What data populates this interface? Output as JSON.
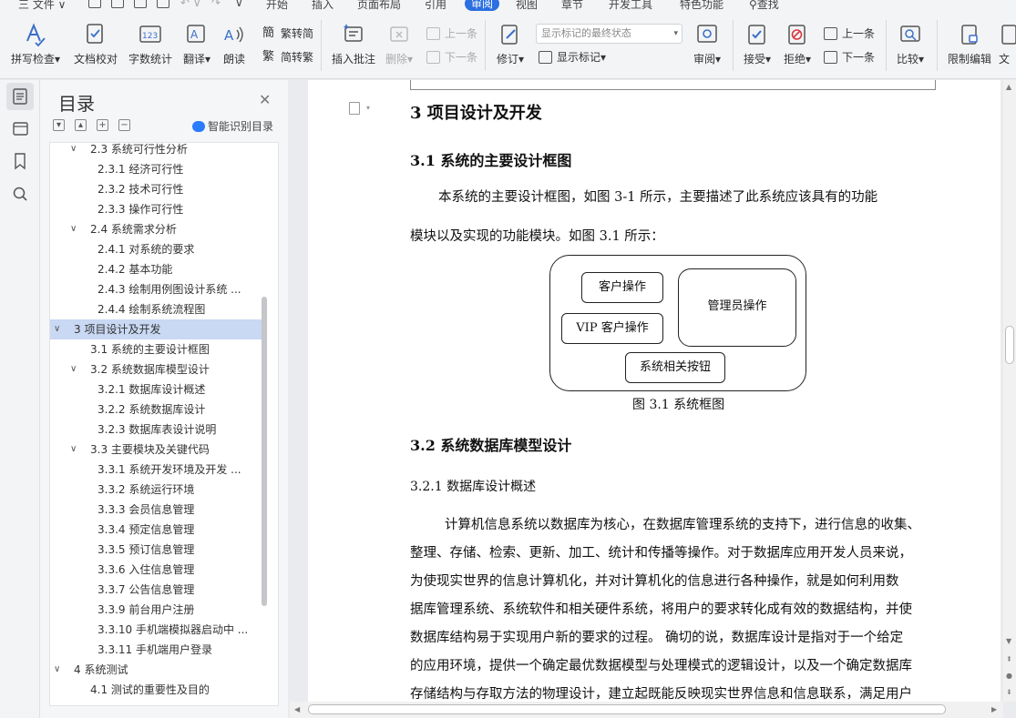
{
  "menubar": {
    "file": "三 文件 ∨",
    "tabs": [
      "开始",
      "插入",
      "页面布局",
      "引用",
      "审阅",
      "视图",
      "章节",
      "开发工具",
      "特色功能"
    ],
    "active_tab": "审阅",
    "search": "查找"
  },
  "toolbar": {
    "spellcheck": "拼写检查",
    "doc_proof": "文档校对",
    "word_count": "字数统计",
    "translate": "翻译",
    "read_aloud": "朗读",
    "trad_to_simp": "繁转简",
    "simp_to_trad": "简转繁",
    "insert_comment": "插入批注",
    "delete": "删除",
    "prev_comment": "上一条",
    "next_comment": "下一条",
    "revise": "修订",
    "markup_state": "显示标记的最终状态",
    "show_markup": "显示标记",
    "review": "审阅",
    "accept": "接受",
    "reject": "拒绝",
    "prev_change": "上一条",
    "next_change": "下一条",
    "compare": "比较",
    "restrict_edit": "限制编辑",
    "doc_right": "文"
  },
  "toc": {
    "title": "目录",
    "smart_label": "智能识别目录",
    "items": [
      {
        "text": "2.3   系统可行性分析",
        "level": 1,
        "chev": "∨"
      },
      {
        "text": "2.3.1   经济可行性",
        "level": 2
      },
      {
        "text": "2.3.2   技术可行性",
        "level": 2
      },
      {
        "text": "2.3.3   操作可行性",
        "level": 2
      },
      {
        "text": "2.4   系统需求分析",
        "level": 1,
        "chev": "∨"
      },
      {
        "text": "2.4.1   对系统的要求",
        "level": 2
      },
      {
        "text": "2.4.2   基本功能",
        "level": 2
      },
      {
        "text": "2.4.3   绘制用例图设计系统 ...",
        "level": 2
      },
      {
        "text": "2.4.4   绘制系统流程图",
        "level": 2
      },
      {
        "text": "3   项目设计及开发",
        "level": 0,
        "chev": "∨",
        "selected": true
      },
      {
        "text": "3.1   系统的主要设计框图",
        "level": 1
      },
      {
        "text": "3.2   系统数据库模型设计",
        "level": 1,
        "chev": "∨"
      },
      {
        "text": "3.2.1   数据库设计概述",
        "level": 2
      },
      {
        "text": "3.2.2   系统数据库设计",
        "level": 2
      },
      {
        "text": "3.2.3   数据库表设计说明",
        "level": 2
      },
      {
        "text": "3.3   主要模块及关键代码",
        "level": 1,
        "chev": "∨"
      },
      {
        "text": "3.3.1   系统开发环境及开发 ...",
        "level": 2
      },
      {
        "text": "3.3.2   系统运行环境",
        "level": 2
      },
      {
        "text": "3.3.3    会员信息管理",
        "level": 2
      },
      {
        "text": "3.3.4   预定信息管理",
        "level": 2
      },
      {
        "text": "3.3.5   预订信息管理",
        "level": 2
      },
      {
        "text": "3.3.6   入住信息管理",
        "level": 2
      },
      {
        "text": "3.3.7   公告信息管理",
        "level": 2
      },
      {
        "text": "3.3.9   前台用户注册",
        "level": 2
      },
      {
        "text": "3.3.10   手机端模拟器启动中 ...",
        "level": 2
      },
      {
        "text": "3.3.11   手机端用户登录",
        "level": 2
      },
      {
        "text": "4   系统测试",
        "level": 0,
        "chev": "∨"
      },
      {
        "text": "4.1   测试的重要性及目的",
        "level": 1
      }
    ]
  },
  "document": {
    "h1": "3   项目设计及开发",
    "h2_1": "3.1   系统的主要设计框图",
    "para1_line1": "本系统的主要设计框图，如图 3-1 所示，主要描述了此系统应该具有的功能",
    "para1_line2": "模块以及实现的功能模块。如图 3.1 所示：",
    "figure": {
      "customer": "客户操作",
      "vip": "VIP 客户操作",
      "admin": "管理员操作",
      "buttons": "系统相关按钮",
      "caption": "图 3.1  系统框图"
    },
    "h2_2": "3.2   系统数据库模型设计",
    "h3_1": "3.2.1    数据库设计概述",
    "para2": [
      "计算机信息系统以数据库为核心，在数据库管理系统的支持下，进行信息的收集、",
      "整理、存储、检索、更新、加工、统计和传播等操作。对于数据库应用开发人员来说，",
      "为使现实世界的信息计算机化，并对计算机化的信息进行各种操作，就是如何利用数",
      "据库管理系统、系统软件和相关硬件系统，将用户的要求转化成有效的数据结构，并使",
      "数据库结构易于实现用户新的要求的过程。 确切的说，数据库设计是指对于一个给定",
      "的应用环境，提供一个确定最优数据模型与处理模式的逻辑设计，以及一个确定数据库",
      "存储结构与存取方法的物理设计，建立起既能反映现实世界信息和信息联系，满足用户"
    ]
  }
}
